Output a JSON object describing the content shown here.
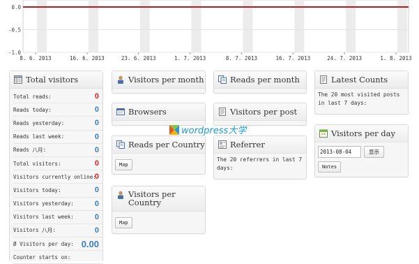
{
  "chart_data": {
    "type": "line",
    "x": [
      "8. 6. 2013",
      "16. 6. 2013",
      "23. 6. 2013",
      "1. 7. 2013",
      "8. 7. 2013",
      "16. 7. 2013",
      "24. 7. 2013",
      "1. 8. 2013"
    ],
    "series": [
      {
        "values": [
          0,
          0,
          0,
          0,
          0,
          0,
          0,
          0
        ]
      }
    ],
    "y_ticks": [
      "0.0",
      "-0.5",
      "-1.0"
    ],
    "ylim": [
      -1.0,
      0.0
    ],
    "grid": true,
    "line_color": "#b71c1c"
  },
  "widgets": {
    "total_visitors": {
      "title": "Total visitors",
      "rows": [
        {
          "label": "Total reads:",
          "value": "0",
          "color": "red"
        },
        {
          "label": "Reads today:",
          "value": "0",
          "color": "blue"
        },
        {
          "label": "Reads yesterday:",
          "value": "0",
          "color": "blue"
        },
        {
          "label": "Reads last week:",
          "value": "0",
          "color": "blue"
        },
        {
          "label": "Reads 八月:",
          "value": "0",
          "color": "blue"
        },
        {
          "label": "Total visitors:",
          "value": "0",
          "color": "red"
        },
        {
          "label": "Visitors currently online:",
          "value": "0",
          "color": "red"
        },
        {
          "label": "Visitors today:",
          "value": "0",
          "color": "blue"
        },
        {
          "label": "Visitors yesterday:",
          "value": "0",
          "color": "blue"
        },
        {
          "label": "Visitors last week:",
          "value": "0",
          "color": "blue"
        },
        {
          "label": "Visitors 八月:",
          "value": "0",
          "color": "blue"
        },
        {
          "label": "Ø Visitors per day:",
          "value": "0.00",
          "color": "blue"
        },
        {
          "label": "Counter starts on:",
          "value": "",
          "color": "blue"
        }
      ]
    },
    "visitors_per_month": {
      "title": "Visitors per month"
    },
    "browsers": {
      "title": "Browsers"
    },
    "reads_per_country": {
      "title": "Reads per Country",
      "button": "Map"
    },
    "visitors_per_country": {
      "title": "Visitors per Country",
      "button": "Map"
    },
    "reads_per_month": {
      "title": "Reads per month"
    },
    "visitors_per_post": {
      "title": "Visitors per post"
    },
    "referrer": {
      "title": "Referrer",
      "text": "The 20 referrers in last 7 days:"
    },
    "latest_counts": {
      "title": "Latest Counts",
      "text": "The 20 most visited posts in last 7 days:"
    },
    "visitors_per_day": {
      "title": "Visitors per day",
      "date_value": "2013-08-04",
      "show_button": "显示",
      "notes_button": "Notes"
    }
  },
  "colors": {
    "red_value": "#d9261c",
    "blue_value": "#3a7fbd"
  },
  "watermark": {
    "text": "wordpress大学"
  }
}
